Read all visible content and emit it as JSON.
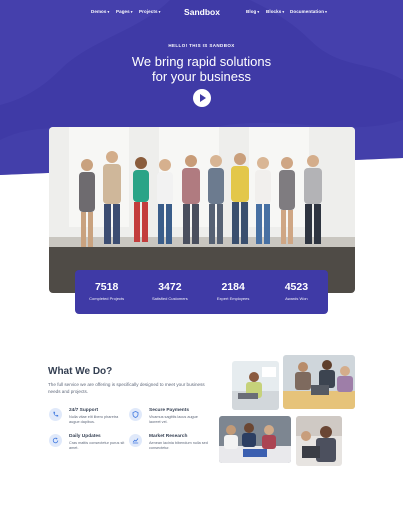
{
  "nav": {
    "left_items": [
      "Demos",
      "Pages",
      "Projects"
    ],
    "logo": "Sandbox",
    "right_items": [
      "Blog",
      "Blocks",
      "Documentation"
    ],
    "caret": "▾"
  },
  "hero": {
    "kicker": "HELLO! THIS IS SANDBOX",
    "headline_line1": "We bring rapid solutions",
    "headline_line2": "for your business",
    "play_icon": "play-icon",
    "brand_color": "#3f3aa6"
  },
  "stats": [
    {
      "value": "7518",
      "label": "Completed Projects"
    },
    {
      "value": "3472",
      "label": "Satisfied Customers"
    },
    {
      "value": "2184",
      "label": "Expert Employees"
    },
    {
      "value": "4523",
      "label": "Awards Won"
    }
  ],
  "what_we_do": {
    "title": "What We Do?",
    "text": "The full service we are offering is specifically designed to meet your business needs and projects.",
    "features": [
      {
        "title": "24/7 Support",
        "desc": "Nulla vitae elit libero pharetra augue dapibus.",
        "icon": "phone-icon"
      },
      {
        "title": "Secure Payments",
        "desc": "Vivamus sagittis lacus augue laoreet vel.",
        "icon": "shield-icon"
      },
      {
        "title": "Daily Updates",
        "desc": "Cras mattis consectetur purus sit amet.",
        "icon": "refresh-icon"
      },
      {
        "title": "Market Research",
        "desc": "Aenean lacinia bibendum nulla sed consectetur.",
        "icon": "chart-icon"
      }
    ]
  }
}
